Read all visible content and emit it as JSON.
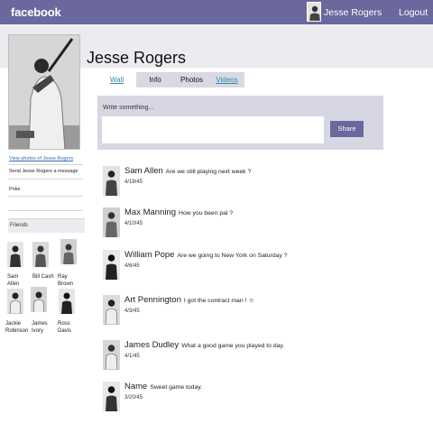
{
  "topbar": {
    "brand": "facebook",
    "user_name": "Jesse Rogers",
    "logout_label": "Logout"
  },
  "profile": {
    "name": "Jesse Rogers"
  },
  "sidebar": {
    "photos_link": "View photos of Jesse Rogers",
    "send_message": "Send Jesse Rogers a message",
    "poke": "Poke",
    "friends_title": "Friends",
    "friends": [
      {
        "first": "Sam",
        "last": "Allen"
      },
      {
        "first": "Bill Cash",
        "last": ""
      },
      {
        "first": "Ray",
        "last": "Brown"
      },
      {
        "first": "Jackie",
        "last": "Robinson"
      },
      {
        "first": "James",
        "last": "Ivory"
      },
      {
        "first": "Ross",
        "last": "Davis"
      }
    ]
  },
  "tabs": [
    {
      "label": "Wall",
      "active": true
    },
    {
      "label": "Info",
      "active": false
    },
    {
      "label": "Photos",
      "active": false
    },
    {
      "label": "Videos",
      "active": false
    }
  ],
  "composer": {
    "placeholder": "Write something...",
    "share_label": "Share"
  },
  "posts": [
    {
      "author": "Sam Allen",
      "message": "Are we still playing next week ?",
      "date": "4/18/45"
    },
    {
      "author": "Max Manning",
      "message": "How you been pal ?",
      "date": "4/10/45"
    },
    {
      "author": "William Pope",
      "message": "Are we going to New York on Saturday ?",
      "date": "4/6/45"
    },
    {
      "author": "Art Pennington",
      "message": "I got  the contract  man ! ☺",
      "date": "4/3/45"
    },
    {
      "author": "James Dudley",
      "message": "What a good game you played to day.",
      "date": "4/1/45"
    },
    {
      "author": "Name",
      "message": "Sweet game today.",
      "date": "3/20/45"
    }
  ],
  "colors": {
    "topbar": "#6a689d",
    "band": "#ebebf0",
    "composer": "#d7d7e3",
    "tab": "#d9d9e3",
    "link": "#2a8fb0"
  }
}
